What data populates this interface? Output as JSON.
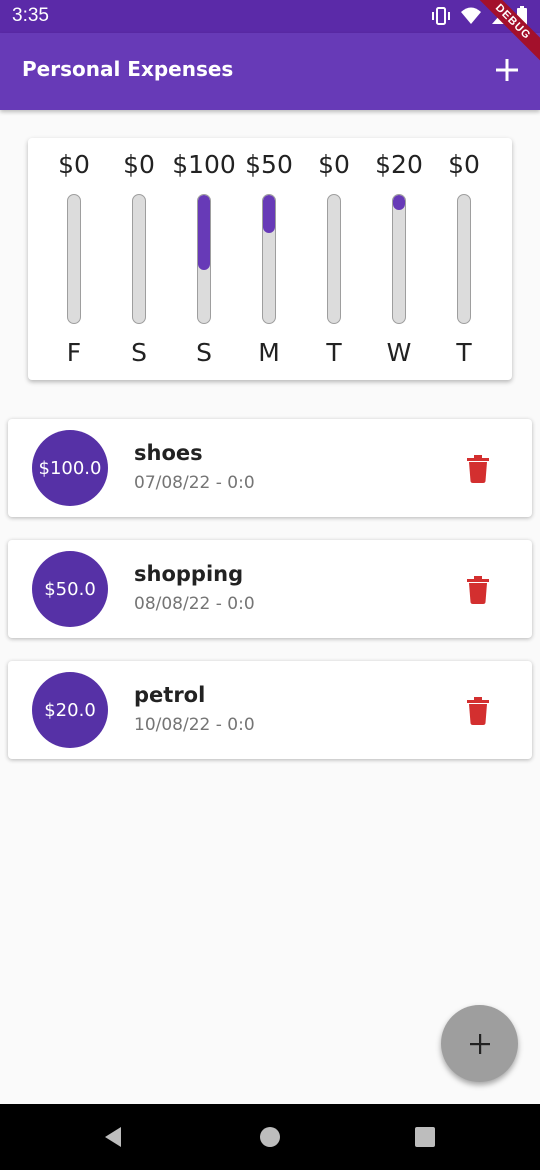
{
  "status_bar": {
    "time": "3:35",
    "debug_label": "DEBUG"
  },
  "app_bar": {
    "title": "Personal Expenses",
    "add_icon": "plus-icon"
  },
  "chart": {
    "accent": "#673ab7",
    "days": [
      {
        "day": "F",
        "amount": "$0",
        "fraction": 0.0
      },
      {
        "day": "S",
        "amount": "$0",
        "fraction": 0.0
      },
      {
        "day": "S",
        "amount": "$100",
        "fraction": 0.588
      },
      {
        "day": "M",
        "amount": "$50",
        "fraction": 0.294
      },
      {
        "day": "T",
        "amount": "$0",
        "fraction": 0.0
      },
      {
        "day": "W",
        "amount": "$20",
        "fraction": 0.118
      },
      {
        "day": "T",
        "amount": "$0",
        "fraction": 0.0
      }
    ]
  },
  "transactions": [
    {
      "amount": "$100.0",
      "title": "shoes",
      "date": "07/08/22 - 0:0"
    },
    {
      "amount": "$50.0",
      "title": "shopping",
      "date": "08/08/22 - 0:0"
    },
    {
      "amount": "$20.0",
      "title": "petrol",
      "date": "10/08/22 - 0:0"
    }
  ],
  "colors": {
    "app_bar": "#673ab7",
    "status_bar": "#5b2aa8",
    "avatar": "#5631a6",
    "delete": "#d32f2f",
    "fab": "#9e9e9e"
  },
  "icons": {
    "delete": "trash-icon",
    "fab": "plus-icon",
    "nav": [
      "back-icon",
      "home-icon",
      "recents-icon"
    ]
  }
}
